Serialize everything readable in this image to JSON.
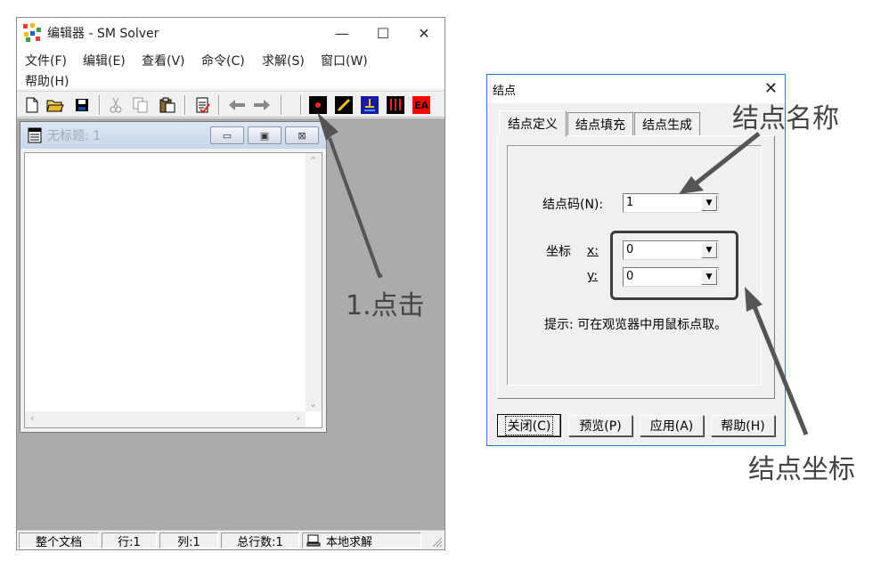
{
  "main_window": {
    "title": "编辑器 - SM Solver",
    "controls": {
      "minimize": "—",
      "maximize": "☐",
      "close": "✕"
    },
    "menus": [
      "文件(F)",
      "编辑(E)",
      "查看(V)",
      "命令(C)",
      "求解(S)",
      "窗口(W)",
      "帮助(H)"
    ],
    "toolbar_icons": [
      "new-document-icon",
      "open-folder-icon",
      "save-disk-icon",
      "cut-icon",
      "copy-icon",
      "paste-icon",
      "check-document-icon",
      "back-arrow-icon",
      "forward-arrow-icon",
      "node-icon",
      "element-icon",
      "support-icon",
      "load-icon",
      "ea-icon"
    ],
    "toolbar_text": {
      "ea": "EA"
    },
    "child_window": {
      "title": "无标题: 1",
      "controls": {
        "minimize": "▭",
        "restore": "▣",
        "close": "⊠"
      }
    },
    "statusbar": [
      "整个文档",
      "行:1",
      "列:1",
      "总行数:1",
      "本地求解"
    ]
  },
  "dialog": {
    "title": "结点",
    "close": "✕",
    "tabs": [
      "结点定义",
      "结点填充",
      "结点生成"
    ],
    "active_tab": "结点定义",
    "node_code_label": "结点码(N):",
    "node_code_value": "1",
    "coord_label": "坐标",
    "x_label": "x:",
    "x_value": "0",
    "y_label": "y:",
    "y_value": "0",
    "hint": "提示: 可在观览器中用鼠标点取。",
    "buttons": [
      "关闭(C)",
      "预览(P)",
      "应用(A)",
      "帮助(H)"
    ]
  },
  "annotations": {
    "click": "1.点击",
    "node_name": "结点名称",
    "node_coords": "结点坐标"
  },
  "colors": {
    "mdi_background": "#ababab",
    "toolbar_red": "#ff2020",
    "dialog_border": "#2b78d1",
    "annotation": "#555555"
  }
}
